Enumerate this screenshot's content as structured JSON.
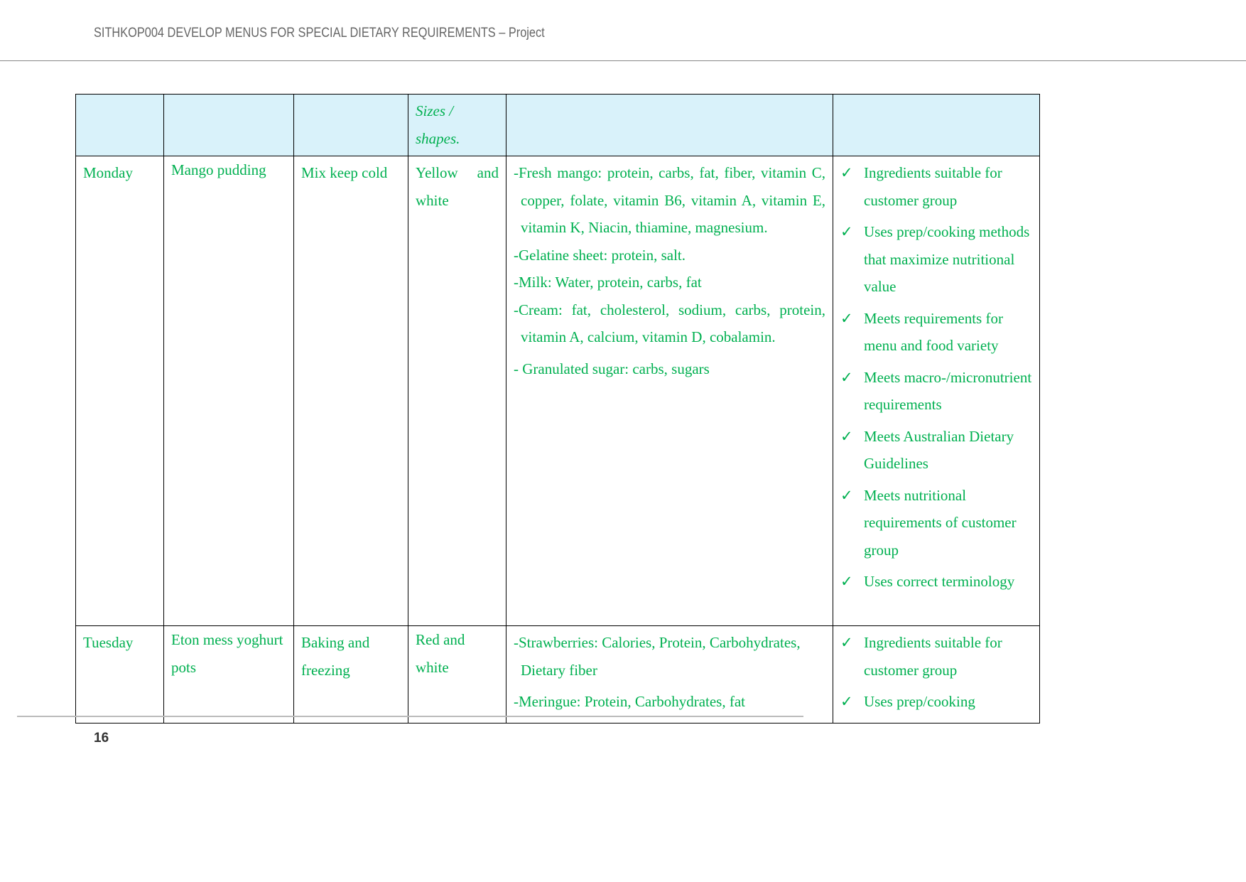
{
  "header": {
    "title": "SITHKOP004 DEVELOP MENUS FOR SPECIAL DIETARY REQUIREMENTS – Project"
  },
  "table": {
    "header_row": {
      "col4": "Sizes / shapes."
    },
    "rows": [
      {
        "day": "Monday",
        "dish": "Mango pudding",
        "method": "Mix keep cold",
        "colour": "Yellow and white",
        "nutrients": [
          "-Fresh mango: protein, carbs, fat, fiber, vitamin C, copper, folate, vitamin B6, vitamin A, vitamin E, vitamin K, Niacin, thiamine, magnesium.",
          "-Gelatine sheet: protein, salt.",
          "-Milk: Water, protein, carbs, fat",
          "-Cream: fat, cholesterol, sodium, carbs, protein, vitamin A, calcium, vitamin D, cobalamin.",
          "- Granulated sugar: carbs, sugars"
        ],
        "checks": [
          "Ingredients suitable for customer group",
          "Uses prep/cooking methods that maximize nutritional value",
          "Meets requirements for menu and food variety",
          "Meets macro-/micronutrient requirements",
          "Meets Australian Dietary Guidelines",
          "Meets nutritional requirements of customer group",
          "Uses correct terminology"
        ]
      },
      {
        "day": "Tuesday",
        "dish": "Eton mess yoghurt pots",
        "method": "Baking and freezing",
        "colour": "Red and white",
        "nutrients": [
          "-Strawberries: Calories, Protein, Carbohydrates, Dietary fiber",
          "-Meringue: Protein, Carbohydrates, fat"
        ],
        "checks": [
          "Ingredients suitable for customer group",
          "Uses prep/cooking"
        ]
      }
    ]
  },
  "footer": {
    "page_number": "16"
  },
  "icons": {
    "check": "check-mark-icon"
  },
  "colors": {
    "text": "#00b050",
    "header_fill": "#d9f2fa"
  }
}
